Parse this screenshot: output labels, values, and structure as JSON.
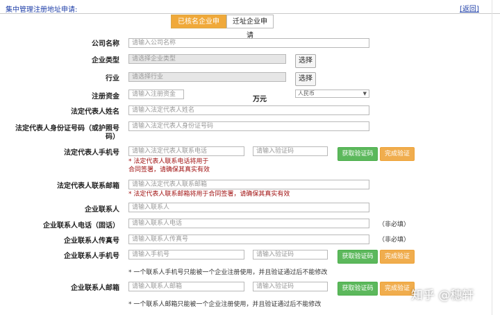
{
  "header": {
    "title": "集中管理注册地址申请:",
    "back": "[返回]"
  },
  "tabs": [
    {
      "label": "已核名企业申请"
    },
    {
      "label": "迁址企业申请"
    }
  ],
  "form": {
    "company_name": {
      "label": "公司名称",
      "placeholder": "请输入公司名称"
    },
    "company_type": {
      "label": "企业类型",
      "placeholder": "请选择企业类型",
      "button": "选择"
    },
    "industry": {
      "label": "行业",
      "placeholder": "请选择行业",
      "button": "选择"
    },
    "capital": {
      "label": "注册资金",
      "placeholder": "请输入注册资金",
      "unit": "万元",
      "currency": "人民币"
    },
    "rep_name": {
      "label": "法定代表人姓名",
      "placeholder": "请输入法定代表人姓名"
    },
    "rep_id": {
      "label": "法定代表人身份证号码（或护照号码）",
      "placeholder": "请输入法定代表人身份证号码"
    },
    "rep_phone": {
      "label": "法定代表人手机号",
      "placeholder": "请输入法定代表人联系电话",
      "code_placeholder": "请输入验证码",
      "get_code": "获取验证码",
      "verify": "完成验证",
      "warning": "* 法定代表人联系电话将用于合同签署，请确保其真实有效"
    },
    "rep_email": {
      "label": "法定代表人联系邮箱",
      "placeholder": "请输入法定代表人联系邮箱",
      "warning": "* 法定代表人联系邮箱将用于合同签署，请确保其真实有效"
    },
    "contact": {
      "label": "企业联系人",
      "placeholder": "请输入联系人"
    },
    "contact_tel": {
      "label": "企业联系人电话（固话）",
      "placeholder": "请输入联系人电话",
      "optional": "（非必填）"
    },
    "contact_fax": {
      "label": "企业联系人传真号",
      "placeholder": "请输入联系人传真号",
      "optional": "（非必填）"
    },
    "contact_mobile": {
      "label": "企业联系人手机号",
      "placeholder": "请输入手机号",
      "code_placeholder": "请输入验证码",
      "get_code": "获取验证码",
      "verify": "完成验证",
      "note": "* 一个联系人手机号只能被一个企业注册使用，并且验证通过后不能修改"
    },
    "contact_email": {
      "label": "企业联系人邮箱",
      "placeholder": "请输入联系人邮箱",
      "code_placeholder": "请输入验证码",
      "get_code": "获取验证码",
      "verify": "完成验证",
      "note": "* 一个联系人邮箱只能被一个企业注册使用，并且验证通过后不能修改"
    }
  },
  "watermark": "知乎 @穗轩"
}
